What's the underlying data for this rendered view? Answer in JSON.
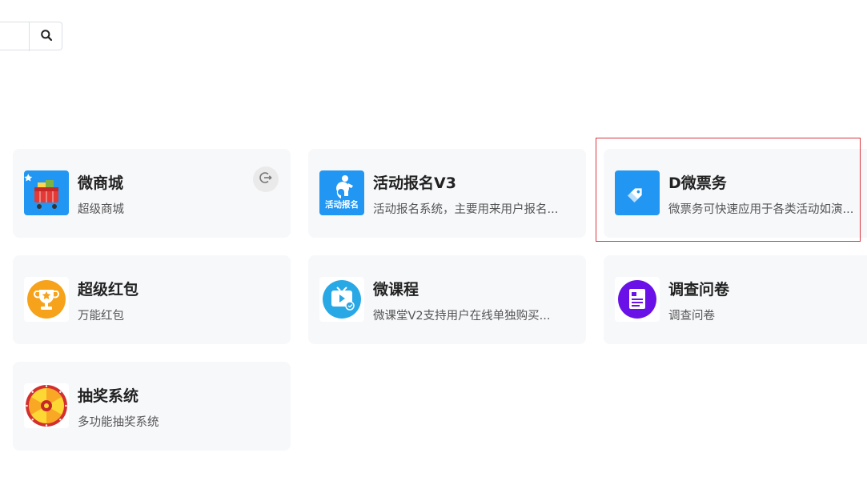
{
  "search": {
    "placeholder": ""
  },
  "apps": [
    {
      "title": "微商城",
      "desc": "超级商城",
      "icon": "shopping-cart-icon"
    },
    {
      "title": "活动报名V3",
      "desc": "活动报名系统，主要用来用户报名...",
      "icon": "event-signup-icon",
      "icon_text": "活动报名"
    },
    {
      "title": "D微票务",
      "desc": "微票务可快速应用于各类活动如演...",
      "icon": "ticket-tag-icon"
    },
    {
      "title": "超级红包",
      "desc": "万能红包",
      "icon": "trophy-icon"
    },
    {
      "title": "微课程",
      "desc": "微课堂V2支持用户在线单独购买...",
      "icon": "tv-course-icon"
    },
    {
      "title": "调查问卷",
      "desc": "调查问卷",
      "icon": "survey-form-icon"
    },
    {
      "title": "抽奖系统",
      "desc": "多功能抽奖系统",
      "icon": "lottery-wheel-icon"
    }
  ],
  "colors": {
    "card_bg": "#f7f8fa",
    "highlight": "#d9363e",
    "blue_icon": "#2196f3",
    "purple_icon": "#6a11e8",
    "orange_icon": "#f6a21a"
  }
}
